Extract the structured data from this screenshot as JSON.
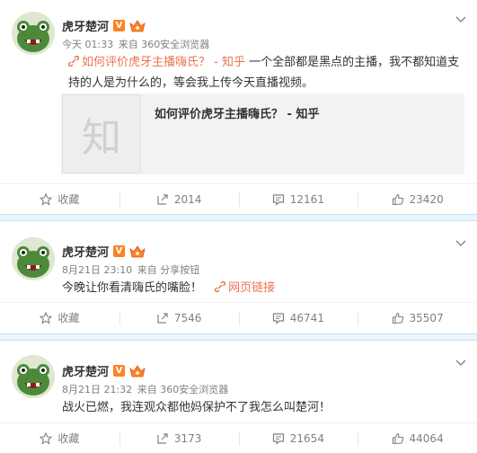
{
  "posts": [
    {
      "name": "虎牙楚河",
      "verified": "V",
      "time": "今天 01:33",
      "from": "来自 360安全浏览器",
      "link_text": "如何评价虎牙主播嗨氏？ - 知乎",
      "body": "一个全部都是黑点的主播，我不都知道支持的人是为什么的，等会我上传今天直播视频。",
      "card_thumb": "知",
      "card_title": "如何评价虎牙主播嗨氏？ - 知乎",
      "actions": {
        "favorite": "收藏",
        "repost": "2014",
        "comment": "12161",
        "like": "23420"
      }
    },
    {
      "name": "虎牙楚河",
      "verified": "V",
      "time": "8月21日 23:10",
      "from": "来自 分享按钮",
      "body": "今晚让你看清嗨氏的嘴脸！",
      "link_text": "网页链接",
      "actions": {
        "favorite": "收藏",
        "repost": "7546",
        "comment": "46741",
        "like": "35507"
      }
    },
    {
      "name": "虎牙楚河",
      "verified": "V",
      "time": "8月21日 21:32",
      "from": "来自 360安全浏览器",
      "body": "战火已燃，我连观众都他妈保护不了我怎么叫楚河！",
      "actions": {
        "favorite": "收藏",
        "repost": "3173",
        "comment": "21654",
        "like": "44064"
      }
    }
  ],
  "colors": {
    "link": "#eb7350",
    "vip": "#fd8225",
    "separator": "#ecf5fb"
  },
  "icons": [
    "avatar-frog",
    "verified-v-icon",
    "vip-crown-icon",
    "chevron-down-icon",
    "link-icon",
    "star-icon",
    "repost-icon",
    "comment-icon",
    "like-icon"
  ]
}
